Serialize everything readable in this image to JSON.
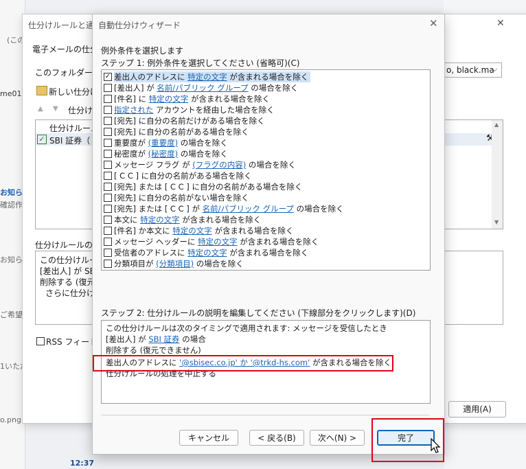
{
  "background": {
    "snippets": [
      "(この",
      "me01",
      "お知ら",
      "確認作業",
      "お知らせ",
      "ご希望",
      "1いただ",
      "o.png",
      "12:37"
    ]
  },
  "rules_dialog": {
    "title": "仕分けルールと通知",
    "email_rules_label": "電子メールの仕分",
    "apply_folder_label": "このフォルダーに変",
    "folder_value": "o, black.ma",
    "new_rule_label": "新しい仕分け",
    "sort_label": "仕分け",
    "column_header": "仕分けルール",
    "rule_item": "SBI 証券（",
    "desc_label": "仕分けルールの説",
    "desc_lines": [
      "この仕分けルー",
      "[差出人] が SBI",
      "削除する (復元",
      "さらに仕分けル"
    ],
    "desc_link": "SBI",
    "rss_label": "RSS フィードか",
    "apply_button": "適用(A)"
  },
  "wizard": {
    "title": "自動仕分けウィザード",
    "heading": "例外条件を選択します",
    "step1_label": "ステップ 1: 例外条件を選択してください (省略可)(C)",
    "conditions": [
      {
        "checked": true,
        "pre": "差出人のアドレスに ",
        "link": "特定の文字",
        "post": " が含まれる場合を除く"
      },
      {
        "checked": false,
        "pre": "[差出人] が ",
        "link": "名前/パブリック グループ",
        "post": " の場合を除く"
      },
      {
        "checked": false,
        "pre": "[件名] に ",
        "link": "特定の文字",
        "post": " が含まれる場合を除く"
      },
      {
        "checked": false,
        "pre": "",
        "link": "指定された",
        "post": " アカウントを経由した場合を除く"
      },
      {
        "checked": false,
        "pre": "[宛先] に自分の名前だけがある場合を除く",
        "link": "",
        "post": ""
      },
      {
        "checked": false,
        "pre": "[宛先] に自分の名前がある場合を除く",
        "link": "",
        "post": ""
      },
      {
        "checked": false,
        "pre": "重要度が ",
        "link": "(重要度)",
        "post": " の場合を除く"
      },
      {
        "checked": false,
        "pre": "秘密度が ",
        "link": "(秘密度)",
        "post": " の場合を除く"
      },
      {
        "checked": false,
        "pre": "メッセージ フラグ が ",
        "link": "(フラグの内容)",
        "post": " の場合を除く"
      },
      {
        "checked": false,
        "pre": "[ C C ] に自分の名前がある場合を除く",
        "link": "",
        "post": ""
      },
      {
        "checked": false,
        "pre": "[宛先] または [ C C ] に自分の名前がある場合を除く",
        "link": "",
        "post": ""
      },
      {
        "checked": false,
        "pre": "[宛先] に自分の名前がない場合を除く",
        "link": "",
        "post": ""
      },
      {
        "checked": false,
        "pre": "[宛先] または [ C C ] が ",
        "link": "名前/パブリック グループ",
        "post": " の場合を除く"
      },
      {
        "checked": false,
        "pre": "本文に ",
        "link": "特定の文字",
        "post": " が含まれる場合を除く"
      },
      {
        "checked": false,
        "pre": "[件名] か本文に ",
        "link": "特定の文字",
        "post": " が含まれる場合を除く"
      },
      {
        "checked": false,
        "pre": "メッセージ ヘッダーに ",
        "link": "特定の文字",
        "post": " が含まれる場合を除く"
      },
      {
        "checked": false,
        "pre": "受信者のアドレスに ",
        "link": "特定の文字",
        "post": " が含まれる場合を除く"
      },
      {
        "checked": false,
        "pre": "分類項目が ",
        "link": "(分類項目)",
        "post": " の場合を除く"
      }
    ],
    "step2_label": "ステップ 2: 仕分けルールの説明を編集してください (下線部分をクリックします)(D)",
    "description": {
      "line1": "この仕分けルールは次のタイミングで適用されます: メッセージを受信したとき",
      "line2_pre": "[差出人] が ",
      "line2_link": "SBI 証券",
      "line2_post": " の場合",
      "line3": "削除する (復元できません)",
      "line4_pre": "差出人のアドレスに ",
      "line4_link": "'@sbisec.co.jp' か '@trkd-hs.com'",
      "line4_post": " が含まれる場合を除く",
      "line5": "仕分けルールの処理を中止する"
    },
    "buttons": {
      "cancel": "キャンセル",
      "back": "< 戻る(B)",
      "next": "次へ(N) >",
      "finish": "完了"
    }
  }
}
